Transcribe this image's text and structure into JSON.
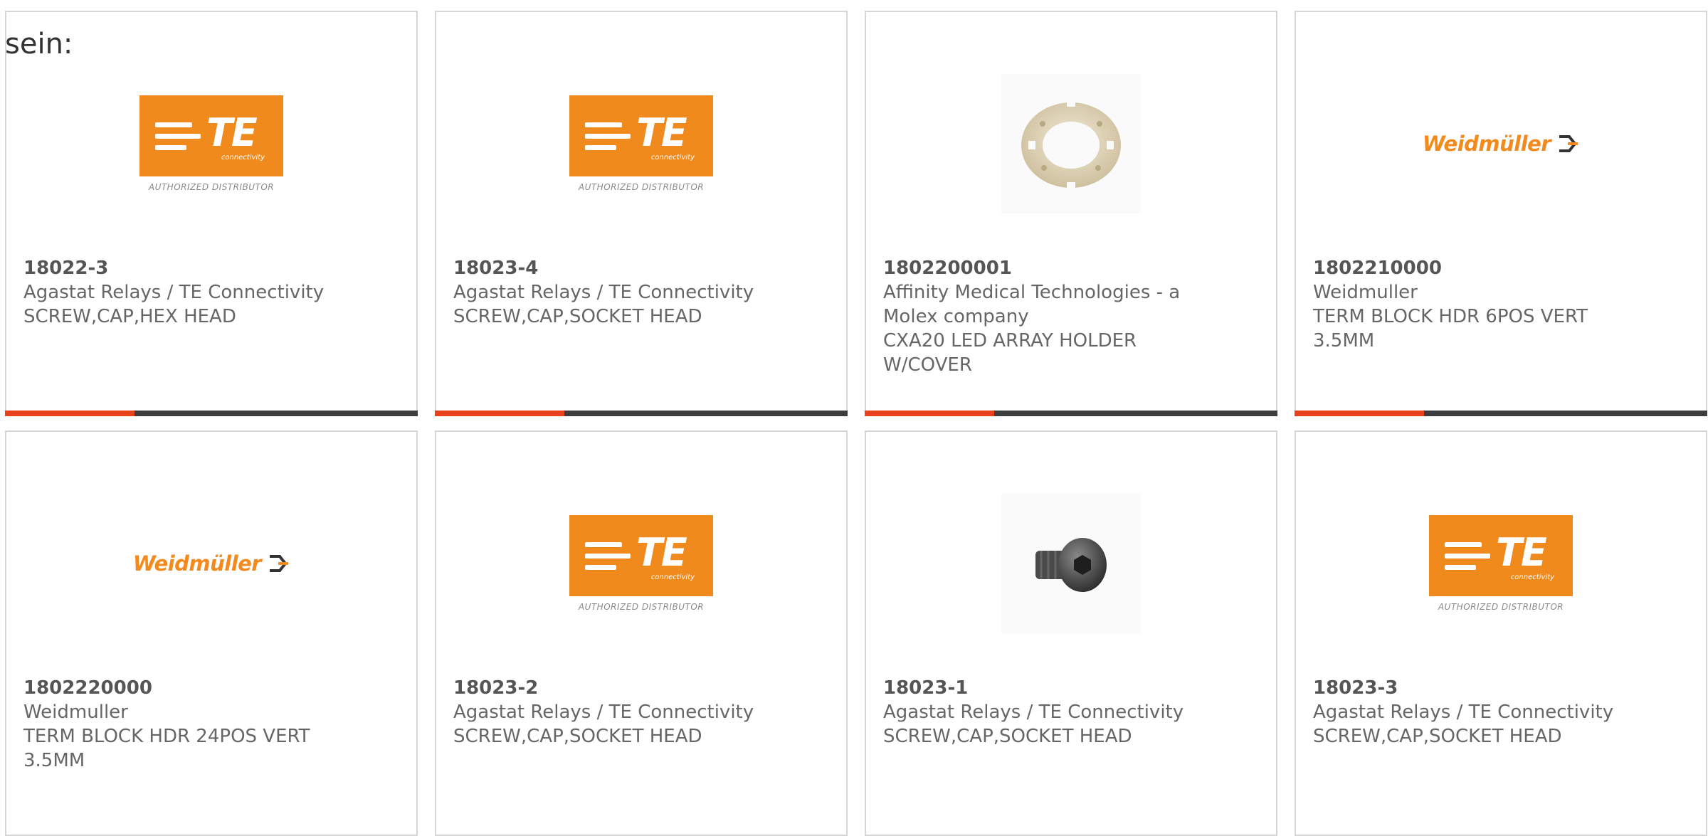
{
  "page": {
    "intro_text": "sein:"
  },
  "colors": {
    "accent": "#e8411c",
    "bar": "#3d3d3d",
    "te_orange": "#f08a1d",
    "weidmuller_orange": "#f28a1e"
  },
  "products": [
    {
      "part_number": "18022-3",
      "manufacturer": "Agastat Relays / TE Connectivity",
      "description": "SCREW,CAP,HEX HEAD",
      "image": "te-logo"
    },
    {
      "part_number": "18023-4",
      "manufacturer": "Agastat Relays / TE Connectivity",
      "description": "SCREW,CAP,SOCKET HEAD",
      "image": "te-logo"
    },
    {
      "part_number": "1802200001",
      "manufacturer": "Affinity Medical Technologies - a Molex company",
      "description": "CXA20 LED ARRAY HOLDER W/COVER",
      "image": "led-array-holder-photo"
    },
    {
      "part_number": "1802210000",
      "manufacturer": "Weidmuller",
      "description": "TERM BLOCK HDR 6POS VERT 3.5MM",
      "image": "weidmuller-logo"
    },
    {
      "part_number": "1802220000",
      "manufacturer": "Weidmuller",
      "description": "TERM BLOCK HDR 24POS VERT 3.5MM",
      "image": "weidmuller-logo"
    },
    {
      "part_number": "18023-2",
      "manufacturer": "Agastat Relays / TE Connectivity",
      "description": "SCREW,CAP,SOCKET HEAD",
      "image": "te-logo"
    },
    {
      "part_number": "18023-1",
      "manufacturer": "Agastat Relays / TE Connectivity",
      "description": "SCREW,CAP,SOCKET HEAD",
      "image": "socket-head-screw-photo"
    },
    {
      "part_number": "18023-3",
      "manufacturer": "Agastat Relays / TE Connectivity",
      "description": "SCREW,CAP,SOCKET HEAD",
      "image": "te-logo"
    }
  ],
  "logos": {
    "te": {
      "wordmark": "TE",
      "sub": "connectivity",
      "tagline": "AUTHORIZED DISTRIBUTOR"
    },
    "weidmuller": {
      "wordmark": "Weidmüller"
    }
  }
}
